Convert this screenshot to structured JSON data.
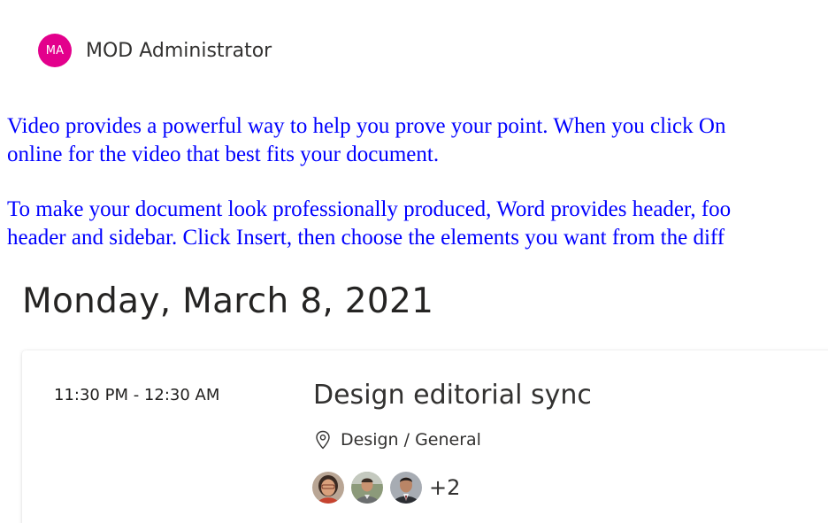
{
  "header": {
    "avatar_initials": "MA",
    "avatar_color": "#e3008c",
    "user_name": "MOD Administrator"
  },
  "document": {
    "text_color": "#0000ff",
    "paragraphs": [
      {
        "lines": [
          "Video provides a powerful way to help you prove your point. When you click On",
          "online for the video that best fits your document."
        ]
      },
      {
        "lines": [
          "To make your document look professionally produced, Word provides header, foo",
          "header and sidebar. Click Insert, then choose the elements you want from the diff"
        ]
      }
    ]
  },
  "agenda": {
    "date_heading": "Monday, March 8, 2021",
    "event": {
      "time": "11:30 PM - 12:30 AM",
      "title": "Design editorial sync",
      "location_icon": "location-pin-icon",
      "location": "Design / General",
      "attendee_photos": [
        "attendee-photo-1",
        "attendee-photo-2",
        "attendee-photo-3"
      ],
      "more_attendees": "+2"
    }
  }
}
